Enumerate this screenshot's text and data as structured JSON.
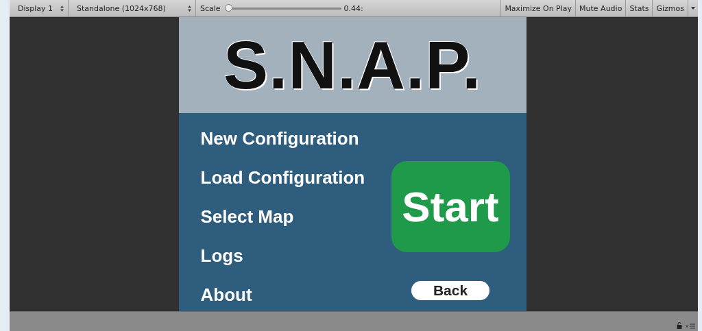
{
  "toolbar": {
    "display": "Display 1",
    "resolution": "Standalone (1024x768)",
    "scale": {
      "label": "Scale",
      "level": 0.0,
      "reading": "0.44:"
    },
    "toggles": [
      "Maximize On Play",
      "Mute Audio",
      "Stats",
      "Gizmos"
    ]
  },
  "game": {
    "title": "S.N.A.P.",
    "menu": [
      "New Configuration",
      "Load Configuration",
      "Select Map",
      "Logs",
      "About"
    ],
    "start_button": "Start",
    "back_button": "Back"
  }
}
